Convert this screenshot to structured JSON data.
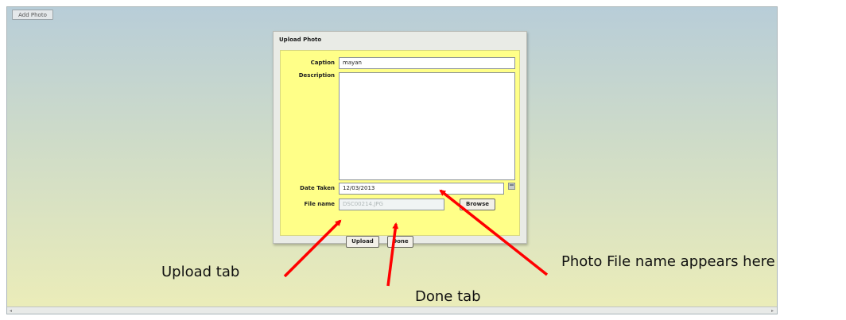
{
  "toolbar": {
    "add_photo_label": "Add Photo"
  },
  "dialog": {
    "title": "Upload Photo",
    "caption_label": "Caption",
    "caption_value": "mayan",
    "description_label": "Description",
    "description_value": "",
    "date_taken_label": "Date Taken",
    "date_taken_value": "12/03/2013",
    "file_name_label": "File name",
    "file_name_value": "DSC00214.JPG",
    "browse_label": "Browse",
    "upload_label": "Upload",
    "done_label": "Done"
  },
  "annotations": {
    "upload": "Upload tab",
    "done": "Done tab",
    "file_name": "Photo File name appears here"
  },
  "colors": {
    "arrow": "#ff0000",
    "form_background": "#ffff88"
  },
  "icons": [
    "calendar-icon",
    "scroll-left-icon",
    "scroll-right-icon"
  ]
}
